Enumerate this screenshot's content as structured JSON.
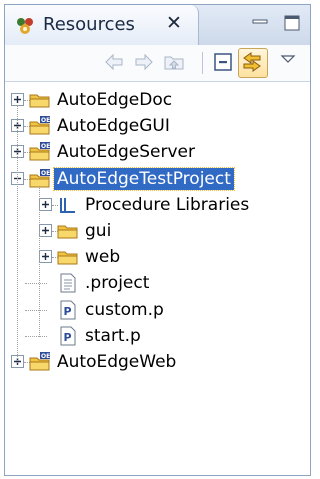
{
  "view": {
    "title": "Resources",
    "close_glyph": "✕",
    "icons": {
      "view": "resources-view-icon",
      "minimize": "minimize-icon",
      "maximize": "maximize-icon"
    }
  },
  "toolbar": {
    "buttons": [
      {
        "name": "back",
        "icon": "arrow-left-icon",
        "enabled": false
      },
      {
        "name": "forward",
        "icon": "arrow-right-icon",
        "enabled": false
      },
      {
        "name": "up",
        "icon": "go-up-folder-icon",
        "enabled": false
      },
      {
        "name": "collapse-all",
        "icon": "collapse-all-icon",
        "enabled": true
      },
      {
        "name": "link-with-editor",
        "icon": "link-with-editor-icon",
        "enabled": true,
        "pressed": true
      },
      {
        "name": "view-menu",
        "icon": "dropdown-triangle-icon",
        "enabled": true
      }
    ]
  },
  "tree": {
    "items": [
      {
        "label": "AutoEdgeDoc",
        "icon": "folder-icon",
        "depth": 0,
        "expander": "plus"
      },
      {
        "label": "AutoEdgeGUI",
        "icon": "oe-project-icon",
        "depth": 0,
        "expander": "plus"
      },
      {
        "label": "AutoEdgeServer",
        "icon": "oe-project-icon",
        "depth": 0,
        "expander": "plus"
      },
      {
        "label": "AutoEdgeTestProject",
        "icon": "oe-project-icon",
        "depth": 0,
        "expander": "minus",
        "selected": true
      },
      {
        "label": "Procedure Libraries",
        "icon": "procedure-libraries-icon",
        "depth": 1,
        "expander": "plus"
      },
      {
        "label": "gui",
        "icon": "folder-icon",
        "depth": 1,
        "expander": "plus"
      },
      {
        "label": "web",
        "icon": "folder-icon",
        "depth": 1,
        "expander": "plus"
      },
      {
        "label": ".project",
        "icon": "text-file-icon",
        "depth": 1,
        "expander": "none"
      },
      {
        "label": "custom.p",
        "icon": "progress-file-icon",
        "depth": 1,
        "expander": "none"
      },
      {
        "label": "start.p",
        "icon": "progress-file-icon",
        "depth": 1,
        "expander": "none"
      },
      {
        "label": "AutoEdgeWeb",
        "icon": "oe-project-icon",
        "depth": 0,
        "expander": "plus"
      }
    ]
  },
  "colors": {
    "selection": "#316ac5",
    "folder": "#f2c443",
    "border": "#8ea4c1"
  }
}
